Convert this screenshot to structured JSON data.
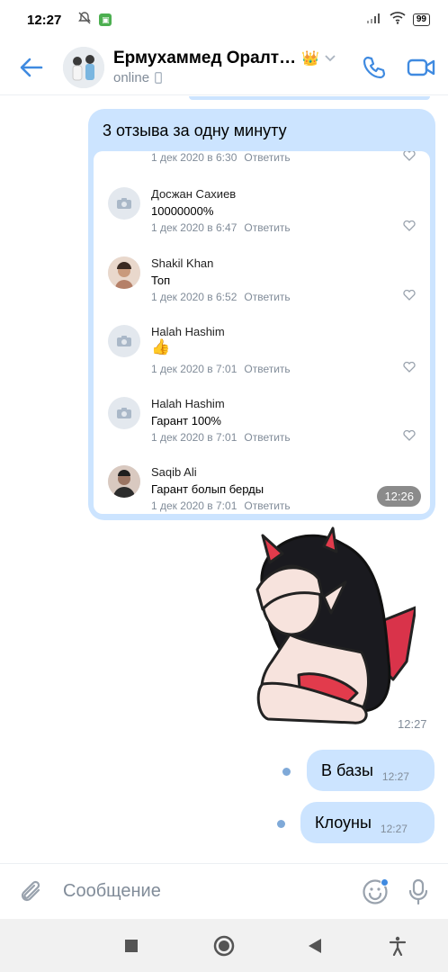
{
  "status_bar": {
    "time": "12:27",
    "battery": "99"
  },
  "header": {
    "name": "Ермухаммед Оралт…",
    "status": "online",
    "crown": "👑"
  },
  "messages": {
    "review_title": "3 отзыва за одну минуту",
    "review_time": "12:26",
    "reviews": [
      {
        "name": "",
        "text": "",
        "date": "1 дек 2020 в 6:30",
        "reply": "Ответить",
        "avatar": "camera-icon"
      },
      {
        "name": "Досжан Сахиев",
        "text": "10000000%",
        "date": "1 дек 2020 в 6:47",
        "reply": "Ответить",
        "avatar": "camera-icon"
      },
      {
        "name": "Shakil Khan",
        "text": "Топ",
        "date": "1 дек 2020 в 6:52",
        "reply": "Ответить",
        "avatar": "photo"
      },
      {
        "name": "Halah Hashim",
        "text": "👍",
        "date": "1 дек 2020 в 7:01",
        "reply": "Ответить",
        "avatar": "camera-icon"
      },
      {
        "name": "Halah Hashim",
        "text": "Гарант 100%",
        "date": "1 дек 2020 в 7:01",
        "reply": "Ответить",
        "avatar": "camera-icon"
      },
      {
        "name": "Saqib Ali",
        "text": "Гарант болып берды",
        "date": "1 дек 2020 в 7:01",
        "reply": "Ответить",
        "avatar": "photo"
      }
    ],
    "sticker_time": "12:27",
    "msg1": {
      "text": "В базы",
      "time": "12:27"
    },
    "msg2": {
      "text": "Клоуны",
      "time": "12:27"
    }
  },
  "composer": {
    "placeholder": "Сообщение"
  },
  "colors": {
    "accent": "#3f8ae0",
    "bubble": "#cce4ff",
    "secondary_text": "#818c99"
  }
}
